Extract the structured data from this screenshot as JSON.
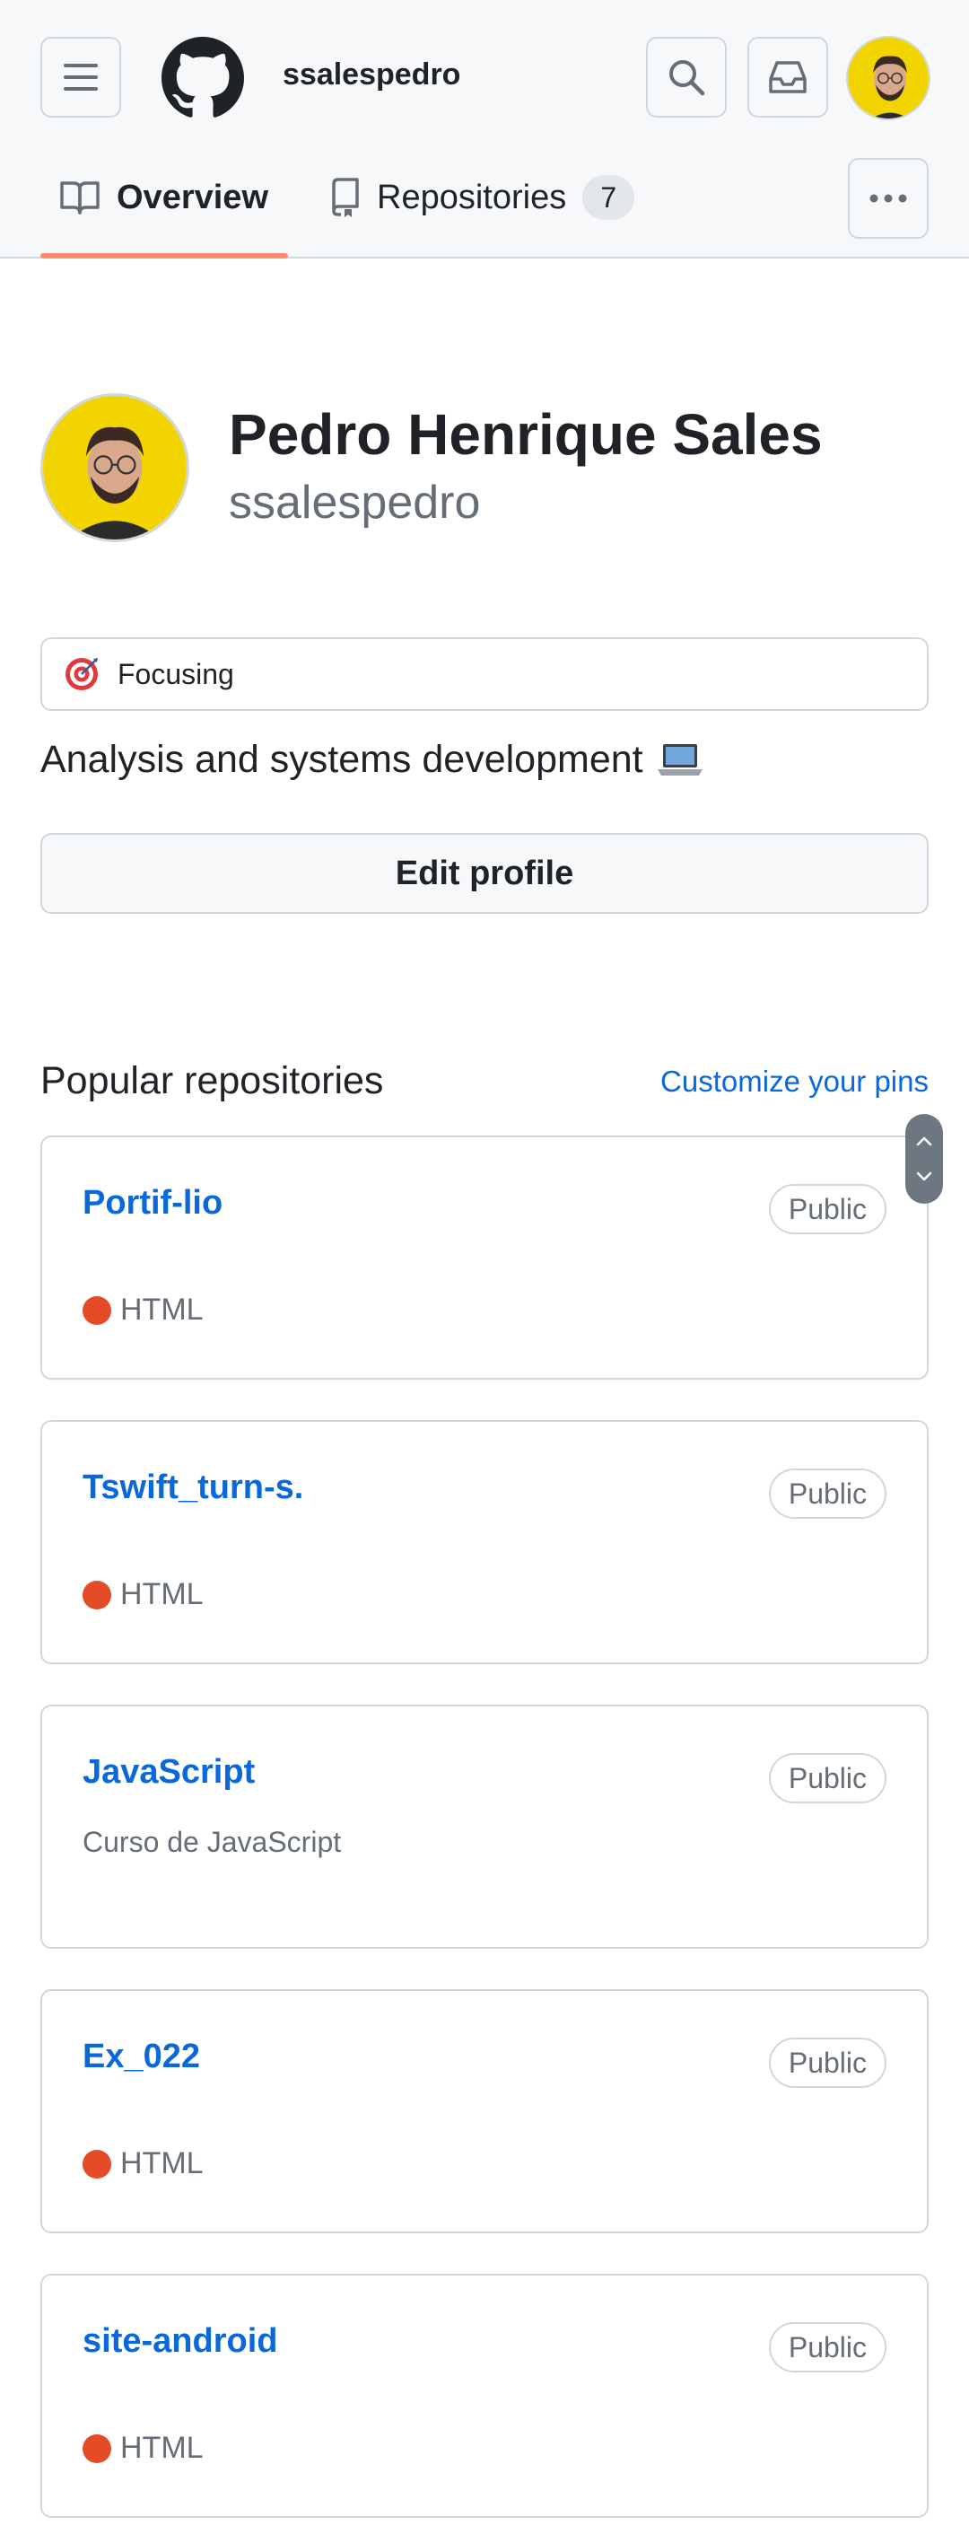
{
  "header": {
    "username": "ssalespedro",
    "tabs": [
      {
        "label": "Overview"
      },
      {
        "label": "Repositories",
        "count": "7"
      }
    ]
  },
  "profile": {
    "full_name": "Pedro Henrique Sales",
    "handle": "ssalespedro",
    "status_text": "Focusing",
    "bio": "Analysis and systems development",
    "bio_emoji": "laptop-emoji",
    "edit_label": "Edit profile"
  },
  "popular": {
    "title": "Popular repositories",
    "customize_label": "Customize your pins",
    "repos": [
      {
        "name": "Portif-lio",
        "visibility": "Public",
        "language": "HTML",
        "lang_color": "#e34c26"
      },
      {
        "name": "Tswift_turn-s.",
        "visibility": "Public",
        "language": "HTML",
        "lang_color": "#e34c26"
      },
      {
        "name": "JavaScript",
        "visibility": "Public",
        "description": "Curso de JavaScript"
      },
      {
        "name": "Ex_022",
        "visibility": "Public",
        "language": "HTML",
        "lang_color": "#e34c26"
      },
      {
        "name": "site-android",
        "visibility": "Public",
        "language": "HTML",
        "lang_color": "#e34c26"
      }
    ]
  },
  "colors": {
    "link": "#0969da",
    "tab_underline": "#fd8c73",
    "border": "#d0d7de",
    "muted_text": "#656d76",
    "avatar_bg": "#f2d400"
  }
}
